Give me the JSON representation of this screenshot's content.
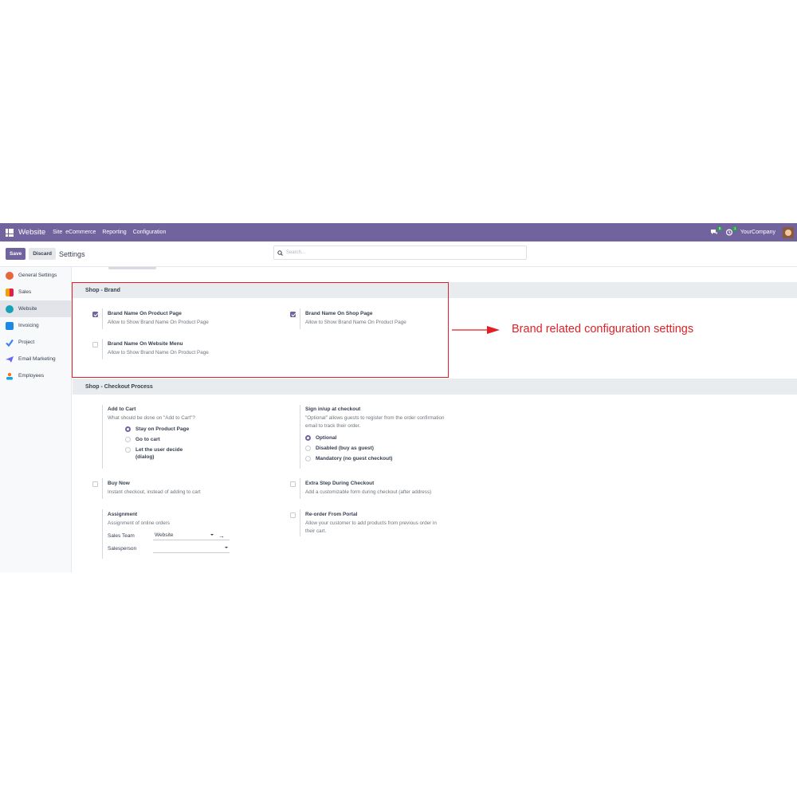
{
  "navbar": {
    "brand": "Website",
    "menu": [
      "Site",
      "eCommerce",
      "Reporting",
      "Configuration"
    ],
    "messages_badge": "5",
    "activity_badge": "1",
    "company": "YourCompany"
  },
  "control_panel": {
    "save_label": "Save",
    "discard_label": "Discard",
    "title": "Settings",
    "search_placeholder": "Search..."
  },
  "sidebar": {
    "items": [
      {
        "label": "General Settings",
        "icon": "general-settings-icon",
        "color": "#e7663a"
      },
      {
        "label": "Sales",
        "icon": "sales-icon",
        "color": "#f59e0b"
      },
      {
        "label": "Website",
        "icon": "website-icon",
        "color": "#17a2b8",
        "active": true
      },
      {
        "label": "Invoicing",
        "icon": "invoicing-icon",
        "color": "#1e88e5"
      },
      {
        "label": "Project",
        "icon": "project-icon",
        "color": "#3b82f6"
      },
      {
        "label": "Email Marketing",
        "icon": "email-marketing-icon",
        "color": "#6366f1"
      },
      {
        "label": "Employees",
        "icon": "employees-icon",
        "color": "#f97316"
      }
    ]
  },
  "brand_section": {
    "title": "Shop - Brand",
    "settings": [
      {
        "label": "Brand Name On Product Page",
        "desc": "Allow to Show Brand Name On Product Page",
        "checked": true
      },
      {
        "label": "Brand Name On Shop Page",
        "desc": "Allow to Show Brand Name On Product Page",
        "checked": true
      },
      {
        "label": "Brand Name On Website Menu",
        "desc": "Allow to Show Brand Name On Product Page",
        "checked": false
      }
    ]
  },
  "checkout_section": {
    "title": "Shop - Checkout Process",
    "add_to_cart": {
      "label": "Add to Cart",
      "desc": "What should be done on \"Add to Cart\"?",
      "options": [
        "Stay on Product Page",
        "Go to cart",
        "Let the user decide",
        "(dialog)"
      ],
      "selected": "Stay on Product Page"
    },
    "sign_in": {
      "label": "Sign in/up at checkout",
      "desc_line1": "\"Optional\" allows guests to register from the order confirmation",
      "desc_line2": "email to track their order.",
      "options": [
        "Optional",
        "Disabled (buy as guest)",
        "Mandatory (no guest checkout)"
      ],
      "selected": "Optional"
    },
    "buy_now": {
      "label": "Buy Now",
      "desc": "Instant checkout, instead of adding to cart",
      "checked": false
    },
    "extra_step": {
      "label": "Extra Step During Checkout",
      "desc": "Add a customizable form during checkout (after address)",
      "checked": false
    },
    "assignment": {
      "label": "Assignment",
      "desc": "Assignment of online orders",
      "sales_team_label": "Sales Team",
      "sales_team_value": "Website",
      "salesperson_label": "Salesperson",
      "salesperson_value": ""
    },
    "reorder": {
      "label": "Re-order From Portal",
      "desc_line1": "Allow your customer to add products from previous order in",
      "desc_line2": "their cart.",
      "checked": false
    }
  },
  "annotation": {
    "text": "Brand related configuration settings",
    "color": "#e21f26"
  }
}
